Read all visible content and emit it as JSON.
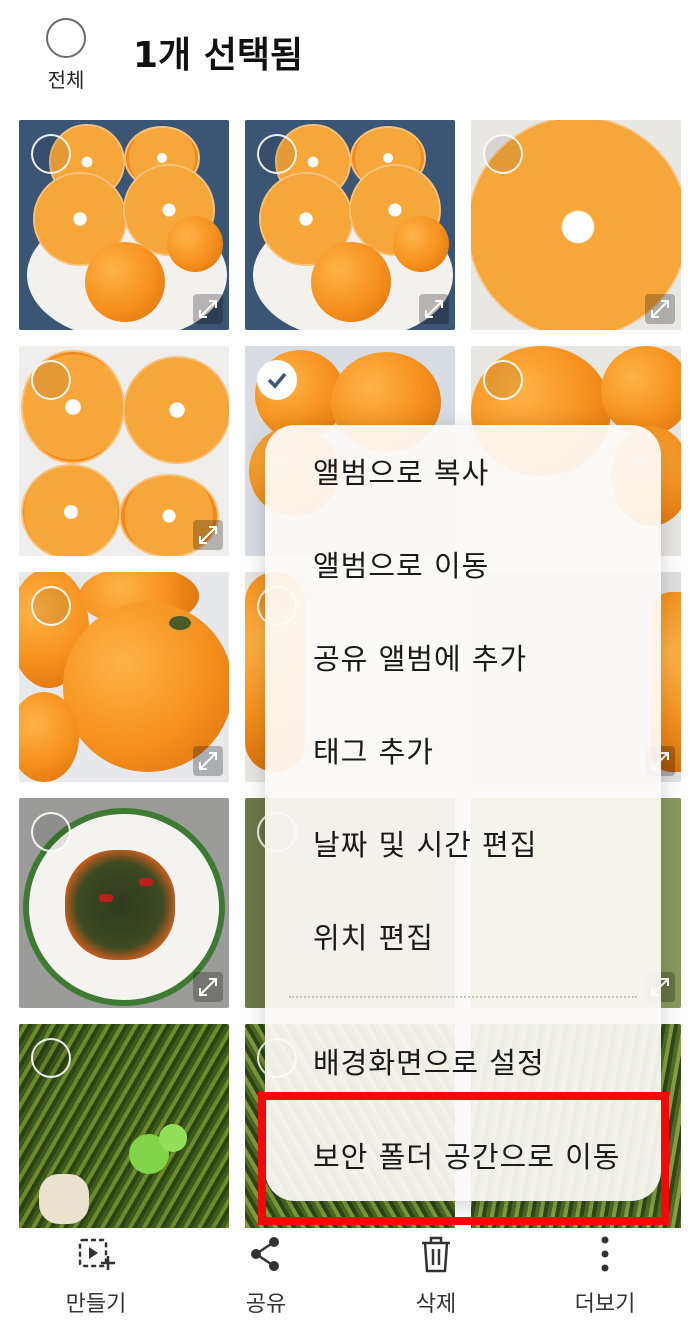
{
  "header": {
    "select_all_label": "전체",
    "title": "1개 선택됨"
  },
  "menu": {
    "items": [
      "앨범으로 복사",
      "앨범으로 이동",
      "공유 앨범에 추가",
      "태그 추가",
      "날짜 및 시간 편집",
      "위치 편집",
      "배경화면으로 설정",
      "보안 폴더 공간으로 이동"
    ],
    "highlight_color": "#f20a0a"
  },
  "photos": {
    "selected_count": 1,
    "selected_index": 4,
    "tiles": [
      "tangerine-halves-plate",
      "tangerine-halves-plate",
      "tangerine-half-closeup",
      "tangerine-four-halves",
      "whole-tangerines-selected",
      "whole-tangerines",
      "whole-tangerines",
      "whole-tangerines",
      "whole-tangerines",
      "seasoned-greens-plate",
      "seasoned-greens",
      "seasoned-greens",
      "green-stems-raw",
      "green-stems-raw",
      "green-stems-raw"
    ]
  },
  "bottom_bar": {
    "create_label": "만들기",
    "share_label": "공유",
    "delete_label": "삭제",
    "more_label": "더보기"
  }
}
